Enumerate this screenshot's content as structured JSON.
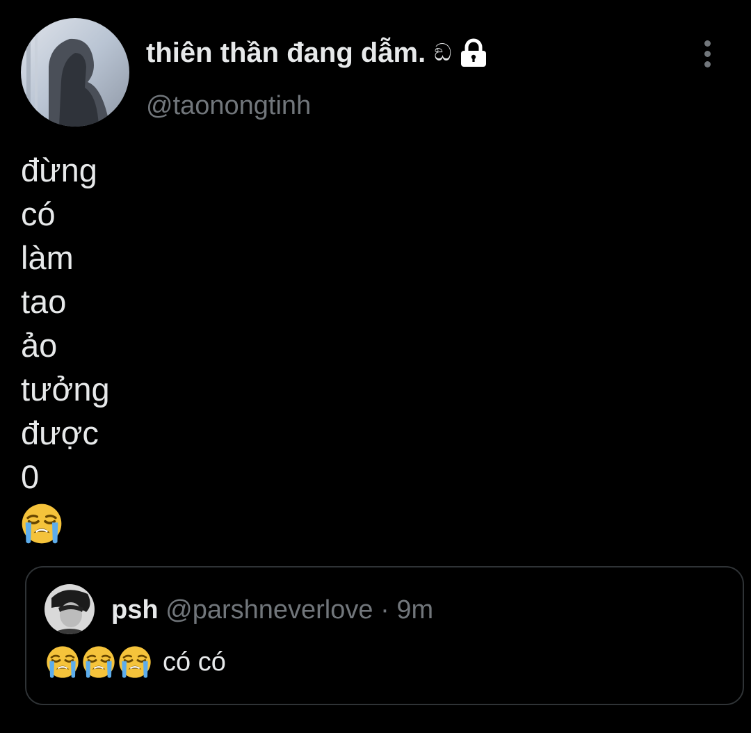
{
  "author": {
    "display_name": "thiên thần đang dẫm.",
    "name_suffix": "ඞ",
    "handle": "@taonongtinh",
    "avatar_icon": "avatar-silhouette",
    "protected_icon": "lock-icon"
  },
  "tweet": {
    "lines": [
      "đừng",
      "có",
      "làm",
      "tao",
      "ảo",
      "tưởng",
      "được",
      "0"
    ],
    "emoji": "loudly-crying-face-icon"
  },
  "quoted_tweet": {
    "name": "psh",
    "handle": "@parshneverlove",
    "separator": "·",
    "time": "9m",
    "emojis": [
      "loudly-crying-face-icon",
      "loudly-crying-face-icon",
      "loudly-crying-face-icon"
    ],
    "text": "có có"
  },
  "colors": {
    "background": "#000000",
    "primary_text": "#e7e9ea",
    "secondary_text": "#71767b",
    "border": "#2f3336",
    "emoji_yellow": "#f5c33b",
    "emoji_tears": "#5dadec"
  },
  "more_icon": "more-vertical-icon"
}
